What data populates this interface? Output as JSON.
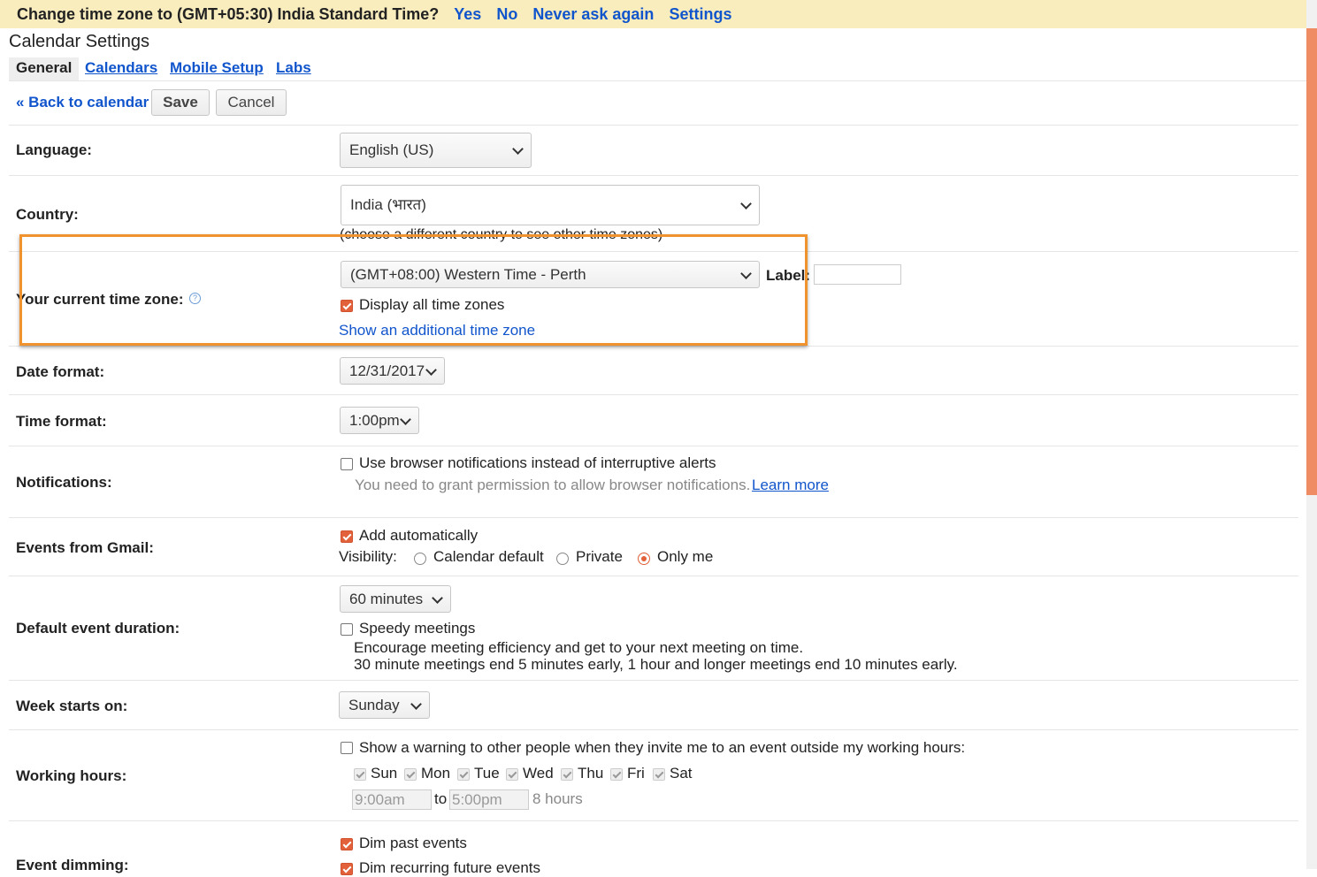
{
  "banner": {
    "message": "Change time zone to (GMT+05:30) India Standard Time?",
    "yes": "Yes",
    "no": "No",
    "never": "Never ask again",
    "settings": "Settings"
  },
  "page_title": "Calendar Settings",
  "tabs": [
    {
      "label": "General",
      "active": true
    },
    {
      "label": "Calendars"
    },
    {
      "label": "Mobile Setup"
    },
    {
      "label": "Labs"
    }
  ],
  "toolbar": {
    "back": "« Back to calendar",
    "save": "Save",
    "cancel": "Cancel"
  },
  "language": {
    "label": "Language:",
    "value": "English (US)"
  },
  "country": {
    "label": "Country:",
    "value": "India (भारत)",
    "hint": "(choose a different country to see other time zones)"
  },
  "timezone": {
    "label": "Your current time zone:",
    "help_icon": "?",
    "value": "(GMT+08:00) Western Time - Perth",
    "tz_label": "Label:",
    "display_all": "Display all time zones",
    "show_additional": "Show an additional time zone"
  },
  "date_format": {
    "label": "Date format:",
    "value": "12/31/2017"
  },
  "time_format": {
    "label": "Time format:",
    "value": "1:00pm"
  },
  "notifications": {
    "label": "Notifications:",
    "option": "Use browser notifications instead of interruptive alerts",
    "hint": "You need to grant permission to allow browser notifications.",
    "learn_more": "Learn more"
  },
  "gmail": {
    "label": "Events from Gmail:",
    "add_auto": "Add automatically",
    "visibility": "Visibility:",
    "opt_default": "Calendar default",
    "opt_private": "Private",
    "opt_only_me": "Only me"
  },
  "duration": {
    "label": "Default event duration:",
    "value": "60 minutes",
    "speedy": "Speedy meetings",
    "desc1": "Encourage meeting efficiency and get to your next meeting on time.",
    "desc2": "30 minute meetings end 5 minutes early, 1 hour and longer meetings end 10 minutes early."
  },
  "week": {
    "label": "Week starts on:",
    "value": "Sunday"
  },
  "working": {
    "label": "Working hours:",
    "warning": "Show a warning to other people when they invite me to an event outside my working hours:",
    "days": [
      "Sun",
      "Mon",
      "Tue",
      "Wed",
      "Thu",
      "Fri",
      "Sat"
    ],
    "start": "9:00am",
    "to": "to",
    "end": "5:00pm",
    "total": "8 hours"
  },
  "dimming": {
    "label": "Event dimming:",
    "past": "Dim past events",
    "recurring": "Dim recurring future events"
  },
  "colors": {
    "accent": "#e2613a",
    "link": "#1155cc",
    "highlight": "#f0922e",
    "banner": "#f9edbe"
  }
}
